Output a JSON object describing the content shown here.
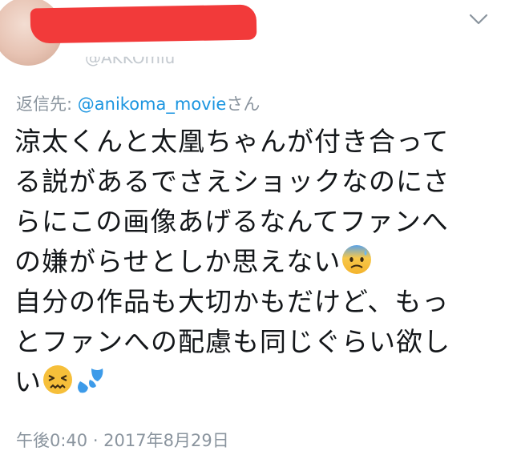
{
  "header": {
    "user_handle": "@AKKOmiu",
    "menu_icon": "chevron-down-icon"
  },
  "reply": {
    "prefix": "返信先: ",
    "mention": "@anikoma_movie",
    "suffix": "さん"
  },
  "tweet": {
    "lines": [
      "涼太くんと太凰ちゃんが付き合って",
      "る説があるでさえショックなのにさ",
      "らにこの画像あげるなんてファンへ",
      "の嫌がらせとしか思えない",
      "自分の作品も大切かもだけど、もっ",
      "とファンへの配慮も同じぐらい欲し",
      "い"
    ],
    "emojis": [
      "anxious-sweat-face-emoji",
      "persevering-face-emoji",
      "sweat-droplets-emoji"
    ]
  },
  "timestamp": "午後0:40 · 2017年8月29日"
}
